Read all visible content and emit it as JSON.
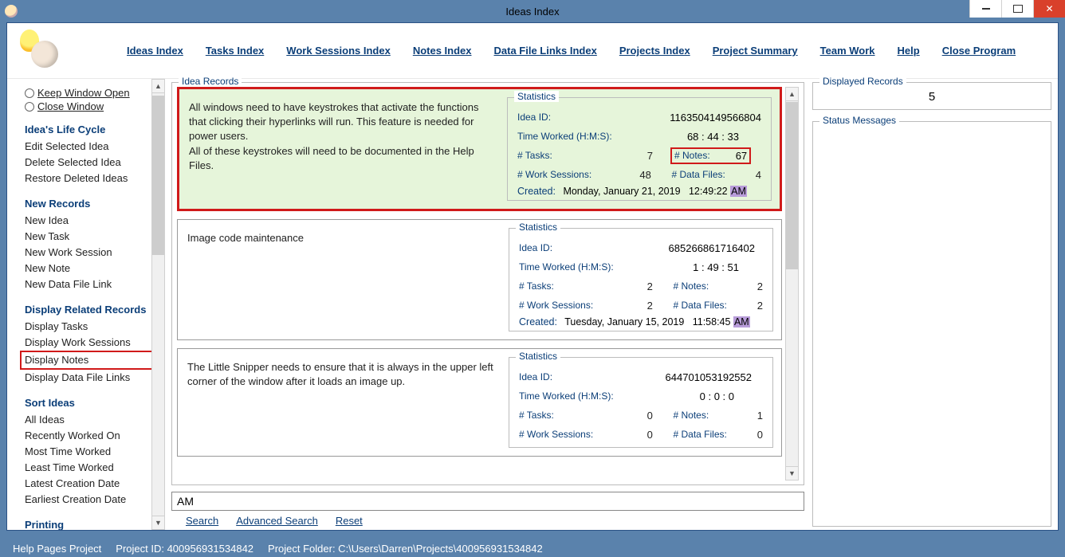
{
  "window": {
    "title": "Ideas Index"
  },
  "menu": {
    "ideas_index": "Ideas Index",
    "tasks_index": "Tasks Index",
    "work_sessions_index": "Work Sessions Index",
    "notes_index": "Notes Index",
    "data_file_links_index": "Data File Links Index",
    "projects_index": "Projects Index",
    "project_summary": "Project Summary",
    "team_work": "Team Work",
    "help": "Help",
    "close_program": "Close Program"
  },
  "sidebar": {
    "keep_window_open": "Keep Window Open",
    "close_window": "Close Window",
    "life_cycle_heading": "Idea's Life Cycle",
    "edit_selected": "Edit Selected Idea",
    "delete_selected": "Delete Selected Idea",
    "restore_deleted": "Restore Deleted Ideas",
    "new_records_heading": "New Records",
    "new_idea": "New Idea",
    "new_task": "New Task",
    "new_work_session": "New Work Session",
    "new_note": "New Note",
    "new_data_file_link": "New Data File Link",
    "display_related_heading": "Display Related Records",
    "display_tasks": "Display Tasks",
    "display_work_sessions": "Display Work Sessions",
    "display_notes": "Display Notes",
    "display_data_file_links": "Display Data File Links",
    "sort_ideas_heading": "Sort Ideas",
    "all_ideas": "All Ideas",
    "recently_worked_on": "Recently Worked On",
    "most_time_worked": "Most Time Worked",
    "least_time_worked": "Least Time Worked",
    "latest_creation_date": "Latest Creation Date",
    "earliest_creation_date": "Earliest Creation Date",
    "printing_heading": "Printing"
  },
  "records_legend": "Idea Records",
  "stats_legend": "Statistics",
  "stat_labels": {
    "idea_id": "Idea ID:",
    "time_worked": "Time Worked (H:M:S):",
    "tasks": "# Tasks:",
    "notes": "# Notes:",
    "work_sessions": "# Work Sessions:",
    "data_files": "# Data Files:",
    "created": "Created:"
  },
  "records": [
    {
      "desc": "All windows need to have keystrokes that activate the functions that clicking their hyperlinks will run. This feature is needed for power users.\nAll of these keystrokes will need to be documented in the Help Files.",
      "idea_id": "1163504149566804",
      "time_worked": "68  :  44  :  33",
      "tasks": "7",
      "notes": "67",
      "work_sessions": "48",
      "data_files": "4",
      "created_date": "Monday, January 21, 2019",
      "created_time": "12:49:22",
      "created_ampm": "AM"
    },
    {
      "desc": "Image code maintenance",
      "idea_id": "685266861716402",
      "time_worked": "1  :  49  :  51",
      "tasks": "2",
      "notes": "2",
      "work_sessions": "2",
      "data_files": "2",
      "created_date": "Tuesday, January 15, 2019",
      "created_time": "11:58:45",
      "created_ampm": "AM"
    },
    {
      "desc": "The Little Snipper needs to ensure that it is always in the upper left corner of the window after it loads an image up.",
      "idea_id": "644701053192552",
      "time_worked": "0  :  0   :  0",
      "tasks": "0",
      "notes": "1",
      "work_sessions": "0",
      "data_files": "0",
      "created_date": "",
      "created_time": "",
      "created_ampm": ""
    }
  ],
  "search": {
    "value": "AM",
    "search": "Search",
    "advanced": "Advanced Search",
    "reset": "Reset"
  },
  "right": {
    "displayed_records_legend": "Displayed Records",
    "displayed_records_value": "5",
    "status_messages_legend": "Status Messages"
  },
  "statusbar": {
    "help_pages": "Help Pages Project",
    "project_id": "Project ID: 400956931534842",
    "project_folder": "Project Folder: C:\\Users\\Darren\\Projects\\400956931534842"
  }
}
